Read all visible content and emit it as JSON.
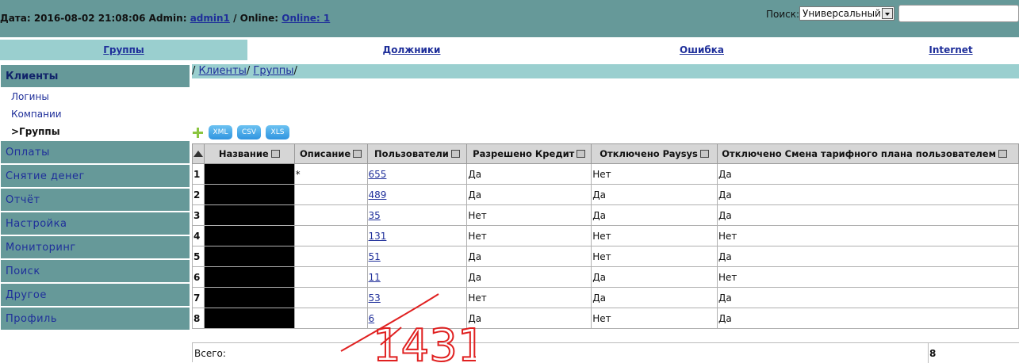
{
  "header": {
    "date_label": "Дата:",
    "date_value": "2016-08-02 21:08:06",
    "admin_label": "Admin:",
    "admin_name": "admin1",
    "online_label": "/ Online:",
    "online_link": "Online: 1",
    "search_label": "Поиск:",
    "search_type": "Универсальный",
    "search_value": ""
  },
  "tabs": [
    {
      "label": "Группы",
      "active": true
    },
    {
      "label": "Должники",
      "active": false
    },
    {
      "label": "Ошибка",
      "active": false
    },
    {
      "label": "Internet",
      "active": false
    }
  ],
  "sidebar": {
    "section": "Клиенты",
    "subitems": [
      "Логины",
      "Компании",
      ">Группы"
    ],
    "items": [
      "Оплаты",
      "Снятие денег",
      "Отчёт",
      "Настройка",
      "Мониторинг",
      "Поиск",
      "Другое",
      "Профиль"
    ]
  },
  "breadcrumb": {
    "sep": "/",
    "items": [
      "Клиенты",
      "Группы"
    ]
  },
  "export_buttons": [
    "XML",
    "CSV",
    "XLS"
  ],
  "table": {
    "columns": [
      "Название",
      "Описание",
      "Пользователи",
      "Разрешено Кредит",
      "Отключено Paysys",
      "Отключено Смена тарифного плана пользователем"
    ],
    "rows": [
      {
        "n": "1",
        "desc": "*",
        "users": "655",
        "credit": "Да",
        "paysys": "Нет",
        "tp": "Да"
      },
      {
        "n": "2",
        "desc": "",
        "users": "489",
        "credit": "Да",
        "paysys": "Да",
        "tp": "Да"
      },
      {
        "n": "3",
        "desc": "",
        "users": "35",
        "credit": "Нет",
        "paysys": "Да",
        "tp": "Да"
      },
      {
        "n": "4",
        "desc": "",
        "users": "131",
        "credit": "Нет",
        "paysys": "Нет",
        "tp": "Нет"
      },
      {
        "n": "5",
        "desc": "",
        "users": "51",
        "credit": "Да",
        "paysys": "Нет",
        "tp": "Да"
      },
      {
        "n": "6",
        "desc": "",
        "users": "11",
        "credit": "Да",
        "paysys": "Да",
        "tp": "Нет"
      },
      {
        "n": "7",
        "desc": "",
        "users": "53",
        "credit": "Нет",
        "paysys": "Да",
        "tp": "Да"
      },
      {
        "n": "8",
        "desc": "",
        "users": "6",
        "credit": "Да",
        "paysys": "Нет",
        "tp": "Да"
      }
    ],
    "total_label": "Всего:",
    "total_value": "8"
  },
  "annotation": {
    "text": "1431",
    "color": "#e02020"
  },
  "colors": {
    "header_bg": "#669999",
    "tab_active": "#9acfcf",
    "link": "#1f2f9a"
  }
}
